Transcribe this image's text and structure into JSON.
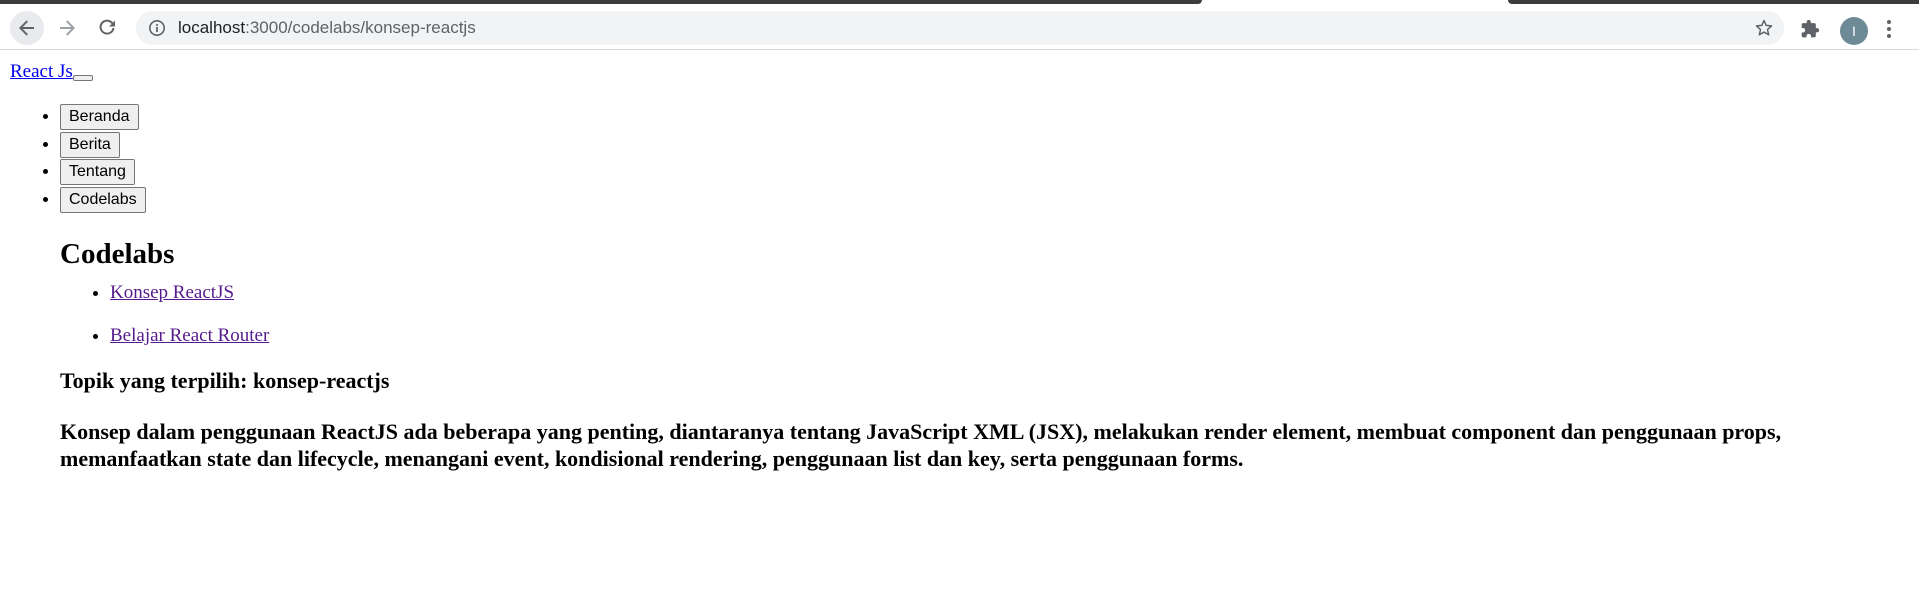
{
  "browser": {
    "url_host": "localhost",
    "url_path": ":3000/codelabs/konsep-reactjs",
    "profile_initial": "I",
    "icons": {
      "back": "arrow-left-icon",
      "forward": "arrow-right-icon",
      "reload": "reload-icon",
      "site_info": "info-icon",
      "bookmark": "star-icon",
      "extensions": "puzzle-icon",
      "menu": "kebab-menu-icon"
    }
  },
  "navbar": {
    "brand": "React Js",
    "menu": [
      {
        "label": "Beranda"
      },
      {
        "label": "Berita"
      },
      {
        "label": "Tentang"
      },
      {
        "label": "Codelabs"
      }
    ]
  },
  "main": {
    "heading": "Codelabs",
    "topics": [
      {
        "label": "Konsep ReactJS"
      },
      {
        "label": "Belajar React Router"
      }
    ],
    "selected_topic": "Topik yang terpilih: konsep-reactjs",
    "description": "Konsep dalam penggunaan ReactJS ada beberapa yang penting, diantaranya tentang JavaScript XML (JSX), melakukan render element, membuat component dan penggunaan props, memanfaatkan state dan lifecycle, menangani event, kondisional rendering, penggunaan list dan key, serta penggunaan forms."
  },
  "colors": {
    "link": "#0000ee",
    "visited_link": "#551a8b",
    "omnibox_bg": "#f1f3f4",
    "avatar_bg": "#6d8a96"
  }
}
